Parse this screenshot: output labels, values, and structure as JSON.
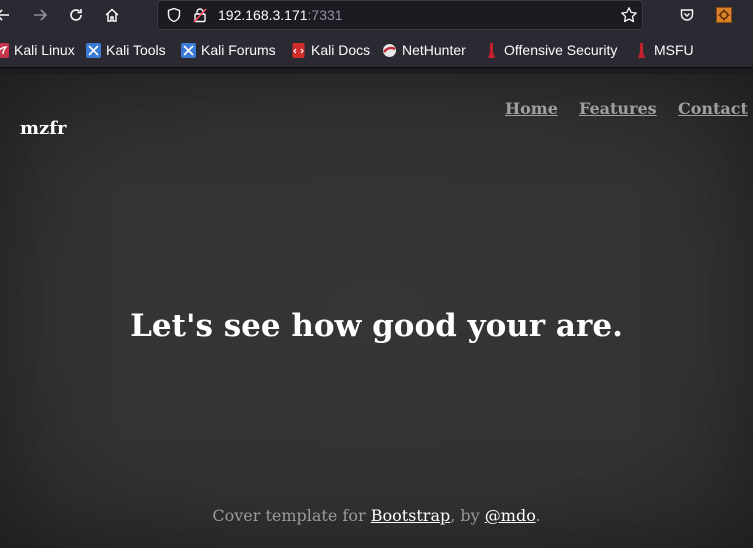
{
  "browser": {
    "url_host": "192.168.3.171",
    "url_port": ":7331",
    "bookmarks": [
      {
        "label": "Kali Linux",
        "icon": "kali-dragon-icon"
      },
      {
        "label": "Kali Tools",
        "icon": "kali-dragon-icon"
      },
      {
        "label": "Kali Forums",
        "icon": "kali-dragon-icon"
      },
      {
        "label": "Kali Docs",
        "icon": "kali-docs-icon"
      },
      {
        "label": "NetHunter",
        "icon": "nethunter-icon"
      },
      {
        "label": "Offensive Security",
        "icon": "offsec-icon"
      },
      {
        "label": "MSFU",
        "icon": "offsec-icon"
      }
    ]
  },
  "page": {
    "brand": "mzfr",
    "nav": {
      "home": "Home",
      "features": "Features",
      "contact": "Contact"
    },
    "headline": "Let's see how good your are.",
    "footer": {
      "prefix": "Cover template for ",
      "link1": "Bootstrap",
      "middle": ", by ",
      "link2": "@mdo",
      "suffix": "."
    }
  },
  "colors": {
    "page_background": "#333333",
    "nav_link": "#a0a0a0",
    "footer_text": "#9a9a9a",
    "toolbar": "#2b2a33"
  }
}
